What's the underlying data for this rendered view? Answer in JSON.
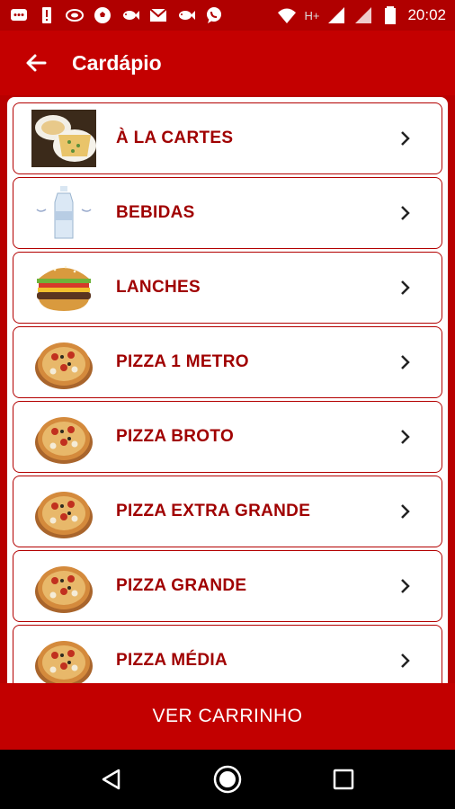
{
  "status_bar": {
    "time": "20:02",
    "network": "H+",
    "icons": [
      "chat-icon",
      "alert-icon",
      "spoon-icon",
      "soccer-ball-icon",
      "fish-icon",
      "gmail-icon",
      "fish-icon",
      "whatsapp-icon",
      "wifi-icon",
      "signal-icon",
      "signal-icon",
      "battery-icon"
    ]
  },
  "app_bar": {
    "back_icon": "arrow-left-icon",
    "title": "Cardápio"
  },
  "menu": {
    "items": [
      {
        "label": "À LA CARTES",
        "thumb": "pasta-dish"
      },
      {
        "label": "BEBIDAS",
        "thumb": "water-bottle"
      },
      {
        "label": "LANCHES",
        "thumb": "burger"
      },
      {
        "label": "PIZZA 1 METRO",
        "thumb": "pizza"
      },
      {
        "label": "PIZZA BROTO",
        "thumb": "pizza"
      },
      {
        "label": "PIZZA EXTRA GRANDE",
        "thumb": "pizza"
      },
      {
        "label": "PIZZA GRANDE",
        "thumb": "pizza"
      },
      {
        "label": "PIZZA MÉDIA",
        "thumb": "pizza"
      }
    ]
  },
  "cart_button": {
    "label": "VER CARRINHO"
  },
  "nav_bar": {
    "icons": [
      "back-triangle-icon",
      "home-circle-icon",
      "recents-square-icon"
    ]
  },
  "colors": {
    "primary": "#c40000",
    "item_text": "#a00000",
    "border": "#b30000"
  }
}
